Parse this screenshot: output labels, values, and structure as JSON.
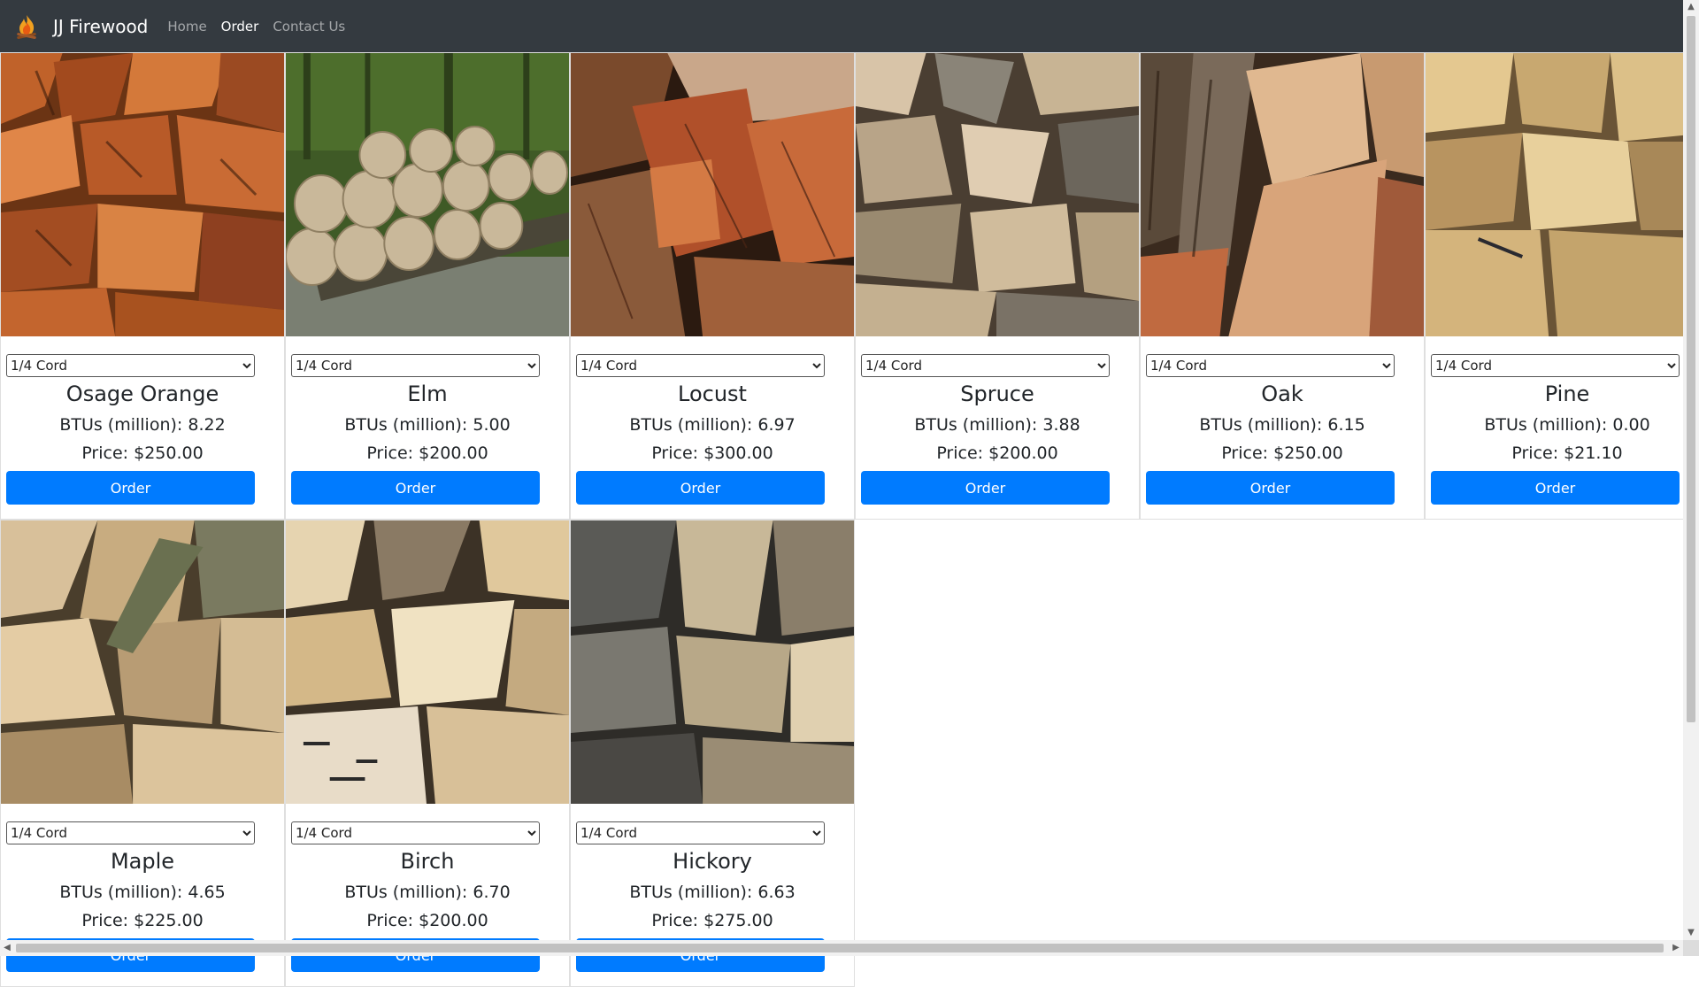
{
  "navbar": {
    "brand": "JJ Firewood",
    "brand_icon": "campfire-icon",
    "links": [
      "Home",
      "Order",
      "Contact Us"
    ],
    "active_link": "Order"
  },
  "colors": {
    "navbar_bg": "#343a40",
    "primary": "#007bff"
  },
  "common": {
    "select_value": "1/4 Cord",
    "order_label": "Order"
  },
  "products": [
    {
      "name": "Osage Orange",
      "btus": "BTUs (million): 8.22",
      "price": "Price: $250.00",
      "image": "osage-orange-firewood-photo"
    },
    {
      "name": "Elm",
      "btus": "BTUs (million): 5.00",
      "price": "Price: $200.00",
      "image": "elm-logs-photo"
    },
    {
      "name": "Locust",
      "btus": "BTUs (million): 6.97",
      "price": "Price: $300.00",
      "image": "locust-firewood-photo"
    },
    {
      "name": "Spruce",
      "btus": "BTUs (million): 3.88",
      "price": "Price: $200.00",
      "image": "spruce-firewood-photo"
    },
    {
      "name": "Oak",
      "btus": "BTUs (million): 6.15",
      "price": "Price: $250.00",
      "image": "oak-firewood-photo"
    },
    {
      "name": "Pine",
      "btus": "BTUs (million): 0.00",
      "price": "Price: $21.10",
      "image": "pine-firewood-photo"
    },
    {
      "name": "Maple",
      "btus": "BTUs (million): 4.65",
      "price": "Price: $225.00",
      "image": "maple-firewood-photo"
    },
    {
      "name": "Birch",
      "btus": "BTUs (million): 6.70",
      "price": "Price: $200.00",
      "image": "birch-firewood-photo"
    },
    {
      "name": "Hickory",
      "btus": "BTUs (million): 6.63",
      "price": "Price: $275.00",
      "image": "hickory-firewood-photo"
    }
  ]
}
